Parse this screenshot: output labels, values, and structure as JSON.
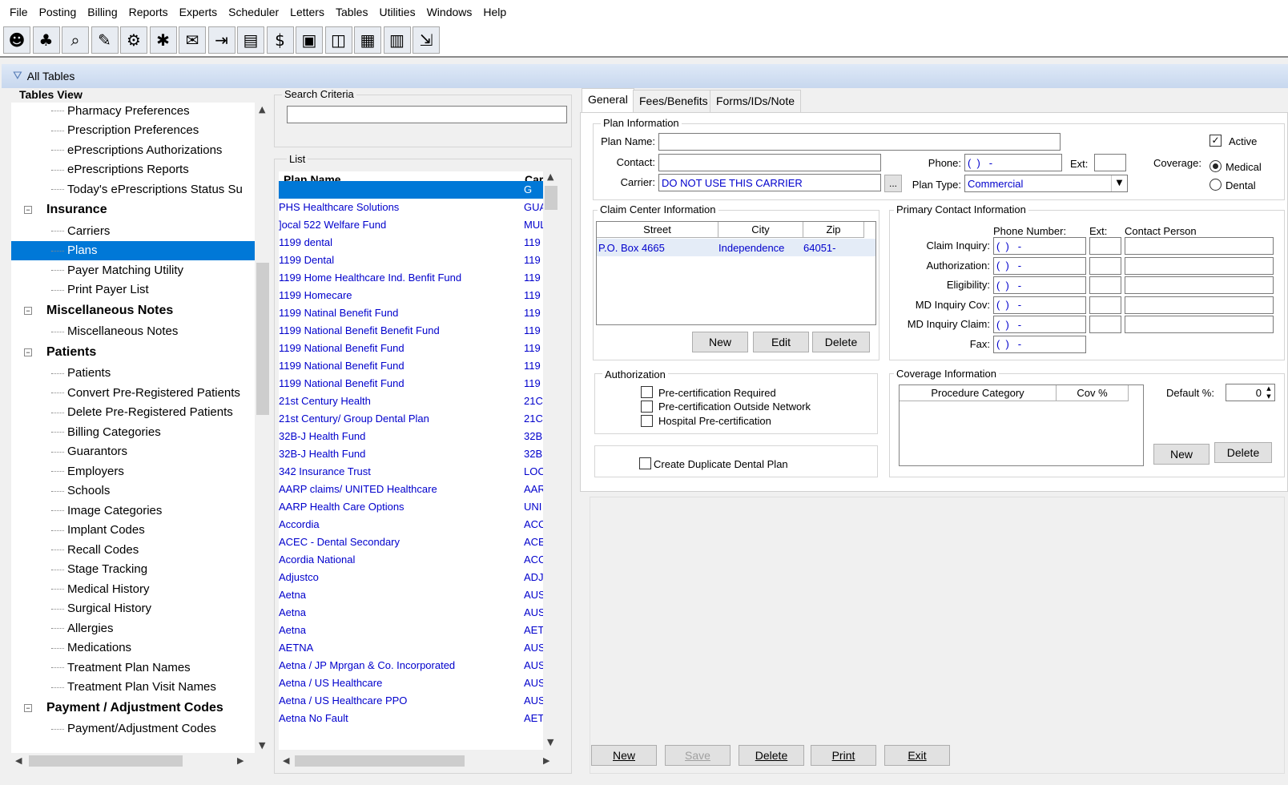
{
  "menu": [
    "File",
    "Posting",
    "Billing",
    "Reports",
    "Experts",
    "Scheduler",
    "Letters",
    "Tables",
    "Utilities",
    "Windows",
    "Help"
  ],
  "toolbar_icons": [
    "patient-icon",
    "tree-icon",
    "search-doc-icon",
    "pen-icon",
    "gear-chart-icon",
    "tooth-icon",
    "letter-icon",
    "door-icon",
    "document-icon",
    "dollar-icon",
    "folder-icon",
    "window-icon",
    "notebook-icon",
    "calendar-icon",
    "exit-icon"
  ],
  "window": {
    "title": "All Tables"
  },
  "tree": {
    "title": "Tables View",
    "items": [
      {
        "label": "Pharmacy Preferences",
        "level": 1
      },
      {
        "label": "Prescription Preferences",
        "level": 1
      },
      {
        "label": "ePrescriptions Authorizations",
        "level": 1
      },
      {
        "label": "ePrescriptions Reports",
        "level": 1
      },
      {
        "label": "Today's ePrescriptions Status Su",
        "level": 1
      },
      {
        "label": "Insurance",
        "level": 0
      },
      {
        "label": "Carriers",
        "level": 1
      },
      {
        "label": "Plans",
        "level": 1,
        "selected": true
      },
      {
        "label": "Payer Matching Utility",
        "level": 1
      },
      {
        "label": "Print Payer List",
        "level": 1
      },
      {
        "label": "Miscellaneous Notes",
        "level": 0
      },
      {
        "label": "Miscellaneous Notes",
        "level": 1
      },
      {
        "label": "Patients",
        "level": 0
      },
      {
        "label": "Patients",
        "level": 1
      },
      {
        "label": "Convert Pre-Registered Patients",
        "level": 1
      },
      {
        "label": "Delete Pre-Registered Patients",
        "level": 1
      },
      {
        "label": "Billing Categories",
        "level": 1
      },
      {
        "label": "Guarantors",
        "level": 1
      },
      {
        "label": "Employers",
        "level": 1
      },
      {
        "label": "Schools",
        "level": 1
      },
      {
        "label": "Image Categories",
        "level": 1
      },
      {
        "label": "Implant Codes",
        "level": 1
      },
      {
        "label": "Recall Codes",
        "level": 1
      },
      {
        "label": "Stage Tracking",
        "level": 1
      },
      {
        "label": "Medical History",
        "level": 1
      },
      {
        "label": "Surgical History",
        "level": 1
      },
      {
        "label": "Allergies",
        "level": 1
      },
      {
        "label": "Medications",
        "level": 1
      },
      {
        "label": "Treatment Plan Names",
        "level": 1
      },
      {
        "label": "Treatment Plan Visit Names",
        "level": 1
      },
      {
        "label": "Payment / Adjustment Codes",
        "level": 0
      },
      {
        "label": "Payment/Adjustment Codes",
        "level": 1
      }
    ]
  },
  "search": {
    "label": "Search Criteria",
    "value": ""
  },
  "list": {
    "label": "List",
    "col_plan": "Plan Name",
    "col_car": "Car",
    "rows": [
      {
        "name": "",
        "car": "G",
        "selected": true
      },
      {
        "name": "PHS Healthcare Solutions",
        "car": "GUA"
      },
      {
        "name": "]ocal 522 Welfare Fund",
        "car": "MUL"
      },
      {
        "name": "1199 dental",
        "car": "119"
      },
      {
        "name": "1199 Dental",
        "car": "119"
      },
      {
        "name": "1199 Home Healthcare Ind. Benfit Fund",
        "car": "119"
      },
      {
        "name": "1199 Homecare",
        "car": "119"
      },
      {
        "name": "1199 Natinal Benefit Fund",
        "car": "119"
      },
      {
        "name": "1199 National Benefit Benefit Fund",
        "car": "119"
      },
      {
        "name": "1199 National Benefit Fund",
        "car": "119"
      },
      {
        "name": "1199 National Benefit Fund",
        "car": "119"
      },
      {
        "name": "1199 National Benefit Fund",
        "car": "119"
      },
      {
        "name": "21st Century Health",
        "car": "21C"
      },
      {
        "name": "21st Century/ Group Dental Plan",
        "car": "21C"
      },
      {
        "name": "32B-J Health Fund",
        "car": "32B."
      },
      {
        "name": "32B-J Health Fund",
        "car": "32B."
      },
      {
        "name": "342 Insurance Trust",
        "car": "LOC"
      },
      {
        "name": "AARP claims/ UNITED Healthcare",
        "car": "AAR"
      },
      {
        "name": "AARP Health Care Options",
        "car": "UNI"
      },
      {
        "name": "Accordia",
        "car": "ACC"
      },
      {
        "name": "ACEC - Dental Secondary",
        "car": "ACE"
      },
      {
        "name": "Acordia National",
        "car": "ACC"
      },
      {
        "name": "Adjustco",
        "car": "ADJ"
      },
      {
        "name": "Aetna",
        "car": "AUS"
      },
      {
        "name": "Aetna",
        "car": "AUS"
      },
      {
        "name": "Aetna",
        "car": "AET"
      },
      {
        "name": "AETNA",
        "car": "AUS"
      },
      {
        "name": "Aetna / JP Mprgan & Co. Incorporated",
        "car": "AUS"
      },
      {
        "name": "Aetna / US Healthcare",
        "car": "AUS"
      },
      {
        "name": "Aetna / US Healthcare PPO",
        "car": "AUS"
      },
      {
        "name": "Aetna No Fault",
        "car": "AET"
      }
    ]
  },
  "tabs": [
    "General",
    "Fees/Benefits",
    "Forms/IDs/Note"
  ],
  "plan_info": {
    "legend": "Plan Information",
    "plan_name_label": "Plan Name:",
    "plan_name": "",
    "contact_label": "Contact:",
    "contact": "",
    "carrier_label": "Carrier:",
    "carrier": "DO NOT USE THIS CARRIER",
    "browse": "...",
    "phone_label": "Phone:",
    "phone": "(  )   -",
    "ext_label": "Ext:",
    "ext": "",
    "plan_type_label": "Plan Type:",
    "plan_type": "Commercial",
    "active_label": "Active",
    "coverage_label": "Coverage:",
    "medical_label": "Medical",
    "dental_label": "Dental"
  },
  "claim_center": {
    "legend": "Claim Center Information",
    "headers": [
      "Street",
      "City",
      "Zip"
    ],
    "rows": [
      {
        "street": "P.O. Box 4665",
        "city": "Independence",
        "zip": "64051-"
      }
    ],
    "new": "New",
    "edit": "Edit",
    "delete": "Delete"
  },
  "primary_contact": {
    "legend": "Primary Contact Information",
    "phone_header": "Phone Number:",
    "ext_header": "Ext:",
    "person_header": "Contact Person",
    "rows": [
      {
        "label": "Claim Inquiry:",
        "phone": "(  )   -"
      },
      {
        "label": "Authorization:",
        "phone": "(  )   -"
      },
      {
        "label": "Eligibility:",
        "phone": "(  )   -"
      },
      {
        "label": "MD Inquiry Cov:",
        "phone": "(  )   -"
      },
      {
        "label": "MD Inquiry Claim:",
        "phone": "(  )   -"
      },
      {
        "label": "Fax:",
        "phone": "(  )   -"
      }
    ]
  },
  "authorization": {
    "legend": "Authorization",
    "items": [
      "Pre-certification Required",
      "Pre-certification Outside Network",
      "Hospital Pre-certification"
    ]
  },
  "duplicate": {
    "label": "Create Duplicate Dental Plan"
  },
  "coverage_info": {
    "legend": "Coverage Information",
    "headers": [
      "Procedure Category",
      "Cov %"
    ],
    "default_label": "Default %:",
    "default_value": "0",
    "new": "New",
    "delete": "Delete"
  },
  "bottom_buttons": {
    "new": "New",
    "save": "Save",
    "delete": "Delete",
    "print": "Print",
    "exit": "Exit"
  }
}
